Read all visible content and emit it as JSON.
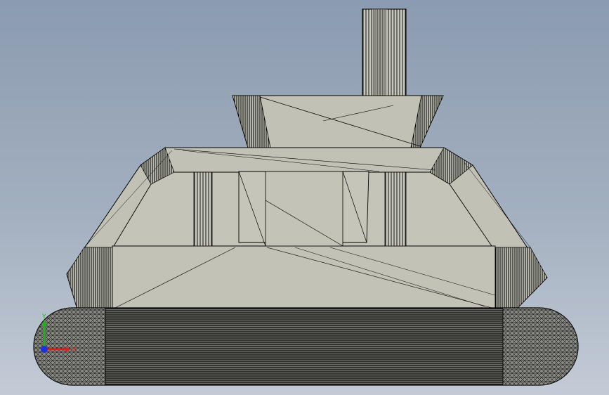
{
  "viewport": {
    "background_top": "#8b9bb0",
    "background_bottom": "#c3cbd6",
    "body_color": "#c2c1b6",
    "edge_color": "#000000"
  },
  "triad": {
    "x_label": "X",
    "y_label": "Y",
    "x_color": "#e02020",
    "y_color": "#20b020",
    "z_color": "#2030e0"
  }
}
